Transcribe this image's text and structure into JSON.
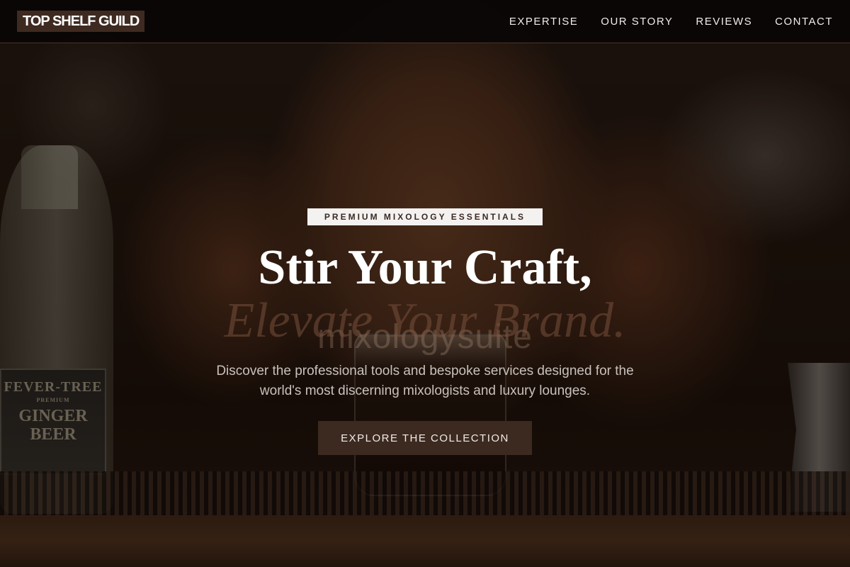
{
  "brand": {
    "logo": "TOP SHELF GUILD"
  },
  "nav": {
    "items": [
      {
        "label": "EXPERTISE"
      },
      {
        "label": "OUR STORY"
      },
      {
        "label": "REVIEWS"
      },
      {
        "label": "CONTACT"
      }
    ]
  },
  "hero": {
    "eyebrow": "PREMIUM MIXOLOGY ESSENTIALS",
    "headline": "Stir Your Craft,",
    "headline_italic": "Elevate Your Brand.",
    "headline_ghost": "mixologysuite",
    "subtitle": "Discover the professional tools and bespoke services designed for the world's most discerning mixologists and luxury lounges.",
    "cta_label": "EXPLORE THE COLLECTION",
    "bottle_label": {
      "line1": "FEVER-TREE",
      "line2": "PREMIUM",
      "line3": "GINGER BEER"
    }
  }
}
